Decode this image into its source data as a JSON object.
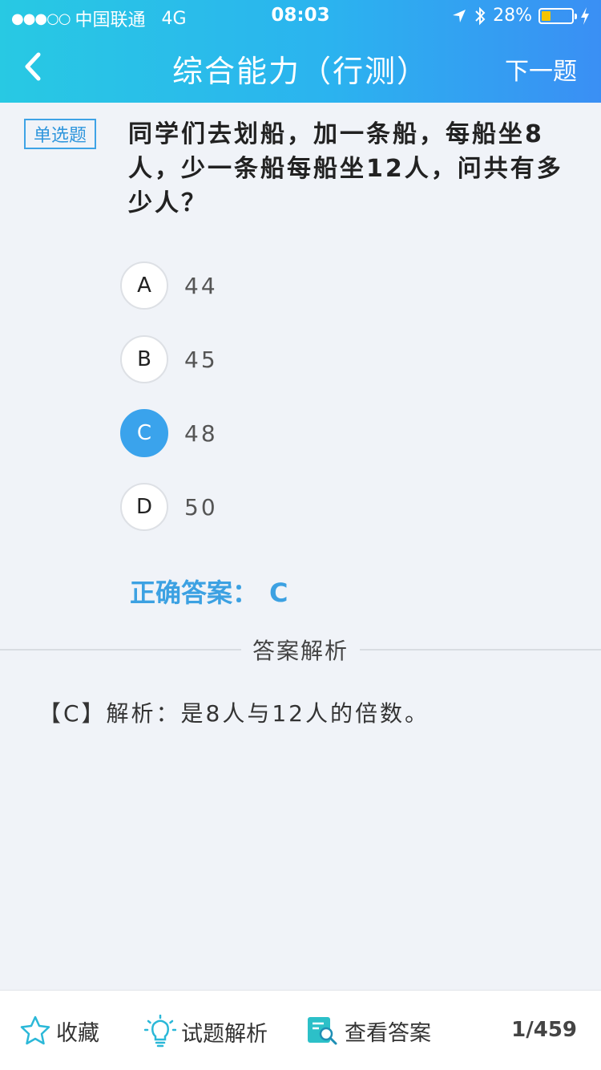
{
  "status_bar": {
    "signal": "●●●○○",
    "carrier": "中国联通",
    "network": "4G",
    "time": "08:03",
    "battery": "28%"
  },
  "header": {
    "title": "综合能力（行测）",
    "next_label": "下一题"
  },
  "question": {
    "type_label": "单选题",
    "text": "同学们去划船，加一条船，每船坐8人，少一条船每船坐12人，问共有多少人？",
    "options": [
      {
        "key": "A",
        "text": "44"
      },
      {
        "key": "B",
        "text": "45"
      },
      {
        "key": "C",
        "text": "48"
      },
      {
        "key": "D",
        "text": "50"
      }
    ],
    "selected": "C",
    "correct_label": "正确答案：",
    "correct_value": "C"
  },
  "analysis": {
    "section_label": "答案解析",
    "text": "【C】解析：是8人与12人的倍数。"
  },
  "bottom_bar": {
    "favorite_label": "收藏",
    "explanation_label": "试题解析",
    "view_answer_label": "查看答案",
    "page_count": "1/459"
  },
  "colors": {
    "accent": "#3aa3ec",
    "header_start": "#28c9e3",
    "header_end": "#3a8ff4"
  }
}
